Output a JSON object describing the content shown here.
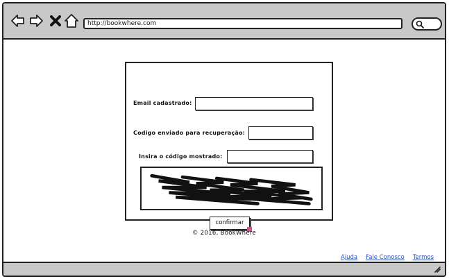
{
  "browser": {
    "url": "http://bookwhere.com",
    "icons": {
      "back": "back-arrow-icon",
      "forward": "forward-arrow-icon",
      "stop": "close-icon",
      "home": "home-icon",
      "search": "search-icon"
    }
  },
  "form": {
    "email_label": "Email cadastrado:",
    "email_value": "",
    "code_label": "Codigo enviado para recuperação:",
    "code_value": "",
    "captcha_label": "Insira o código mostrado:",
    "captcha_value": "",
    "confirm_label": "confirmar"
  },
  "footer": {
    "copyright": "© 2016, BookWhere",
    "links": [
      "Ajuda",
      "Fale Conosco",
      "Termos"
    ]
  },
  "colors": {
    "chrome": "#c8c8c8",
    "link": "#2a4fb5",
    "cursor": "#c05a8a"
  }
}
